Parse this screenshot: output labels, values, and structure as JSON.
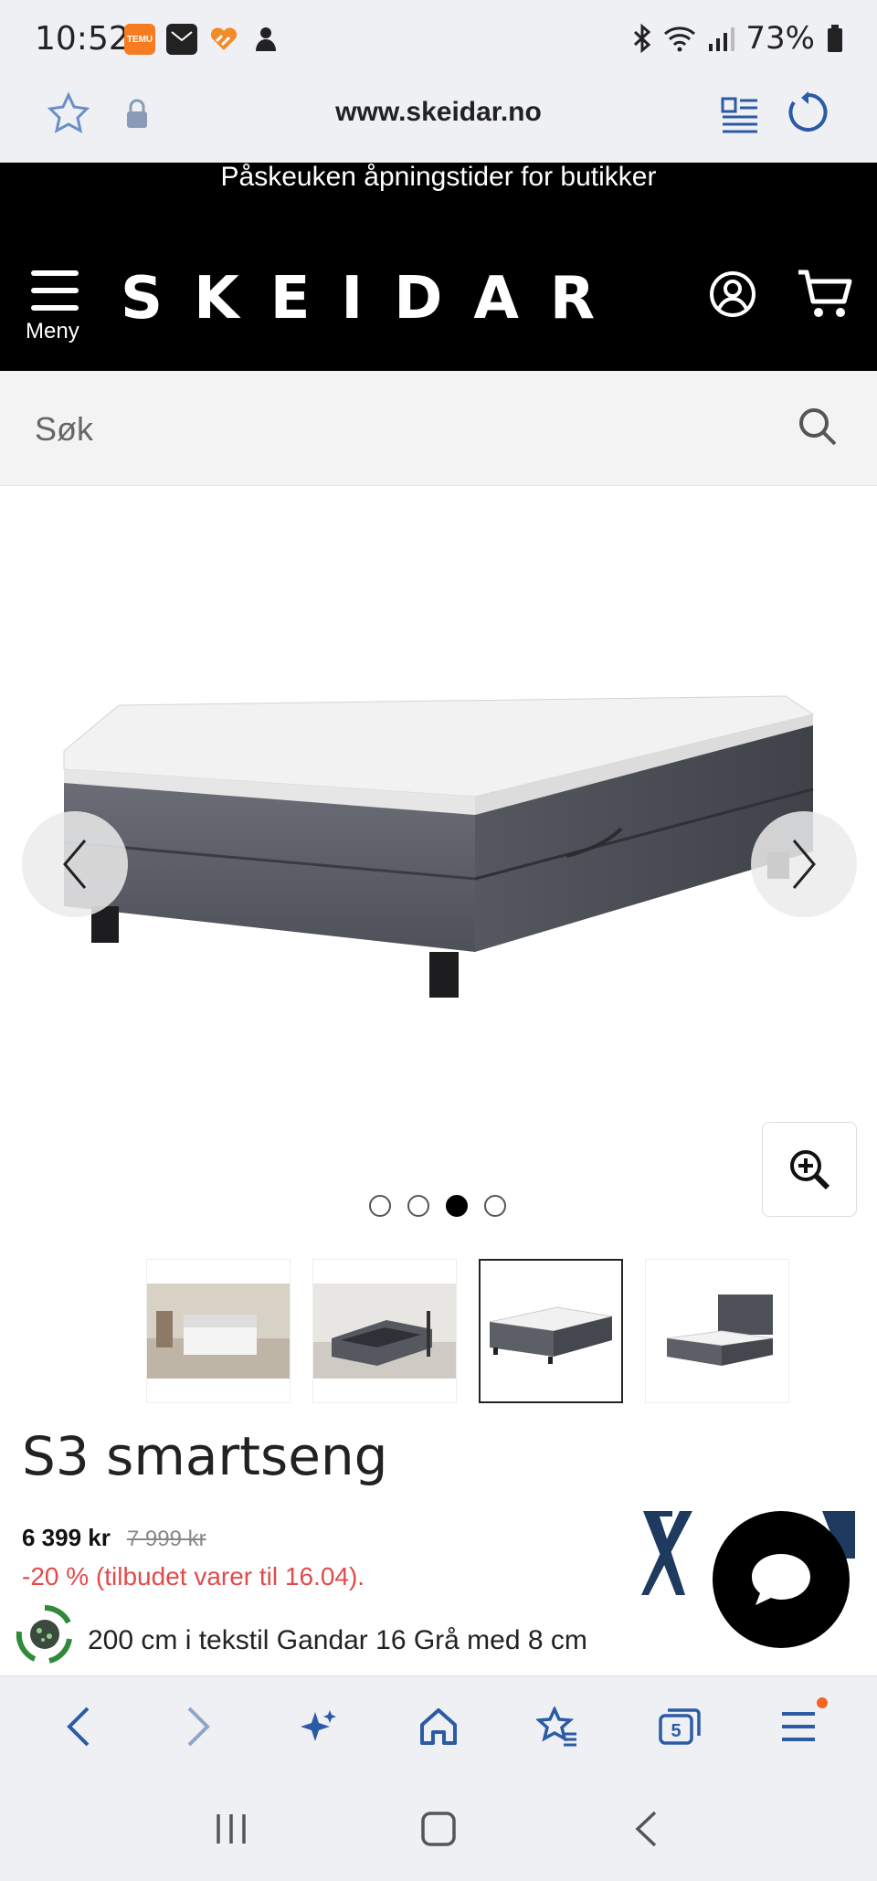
{
  "status_bar": {
    "time": "10:52",
    "battery": "73%",
    "temu_label": "TEMU"
  },
  "browser": {
    "url": "www.skeidar.no"
  },
  "site": {
    "announcement": "Påskeuken åpningstider for butikker",
    "logo": "SKEIDAR",
    "menu_label": "Meny",
    "search_placeholder": "Søk"
  },
  "gallery": {
    "dot_count": 4,
    "active_index": 3,
    "thumbnails": [
      "bedroom-scene",
      "storage-open-scene",
      "grey-storage-bed",
      "bed-with-headboard"
    ]
  },
  "product": {
    "title": "S3 smartseng",
    "price": "6 399 kr",
    "old_price": "7 999 kr",
    "offer": "-20 % (tilbudet varer til 16.04).",
    "description": "200 cm i tekstil Gandar 16 Grå med 8 cm"
  },
  "bottom_nav": {
    "tabs_count": "5"
  },
  "colors": {
    "header_bg": "#000000",
    "offer_red": "#e24a4a",
    "browser_blue": "#2b5aa6",
    "chrome_bg": "#eef0f4"
  }
}
